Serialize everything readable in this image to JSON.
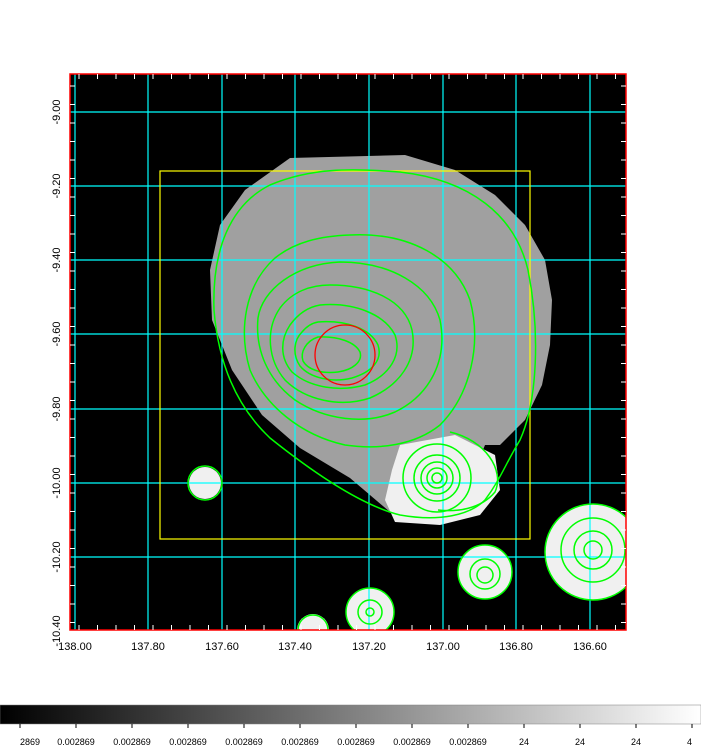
{
  "plot": {
    "x_tick_labels": [
      "138.00",
      "137.80",
      "137.60",
      "137.40",
      "137.20",
      "137.00",
      "136.80",
      "136.60"
    ],
    "y_tick_labels": [
      "-9.00",
      "-9.20",
      "-9.40",
      "-9.60",
      "-9.80",
      "-10.00",
      "-10.20",
      "-10.40"
    ]
  },
  "colorbar": {
    "labels": [
      "2869",
      "0.002869",
      "0.002869",
      "0.002869",
      "0.002869",
      "0.002869",
      "0.002869",
      "0.002869",
      "0.002869",
      "24",
      "24",
      "24",
      "4"
    ]
  },
  "colors": {
    "background": "#000000",
    "emission": "#a0a0a0",
    "source": "#f0f0f0",
    "contour": "#00ff00",
    "grid": "#00ffff",
    "region_box": "#ffff00",
    "region_circle": "#ff0000",
    "frame": "#ff0000"
  }
}
